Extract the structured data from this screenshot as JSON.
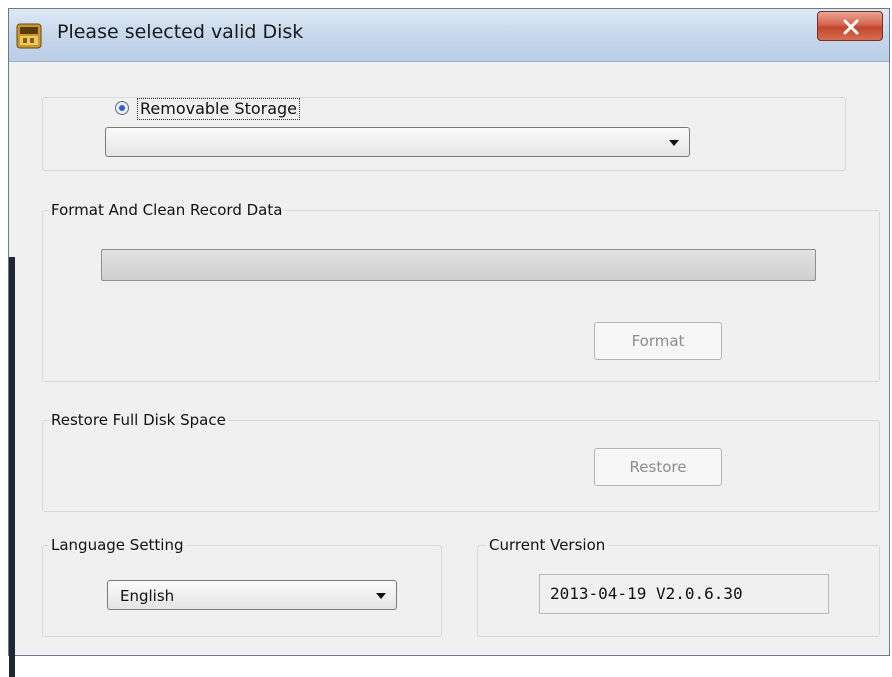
{
  "window": {
    "title": "Please selected valid Disk",
    "close_icon": "close-x-icon",
    "app_icon": "app-icon"
  },
  "storage": {
    "radio_label": "Removable Storage",
    "radio_checked": true,
    "disk_selected": ""
  },
  "format_group": {
    "label": "Format And Clean Record Data",
    "progress": 0,
    "button_label": "Format",
    "button_enabled": false
  },
  "restore_group": {
    "label": "Restore Full Disk Space",
    "button_label": "Restore",
    "button_enabled": false
  },
  "language": {
    "label": "Language Setting",
    "selected": "English"
  },
  "version": {
    "label": "Current Version",
    "value": "2013-04-19 V2.0.6.30"
  },
  "colors": {
    "accent": "#2a62c9",
    "close_button": "#c2462c",
    "window_bg": "#f0f0f0"
  }
}
